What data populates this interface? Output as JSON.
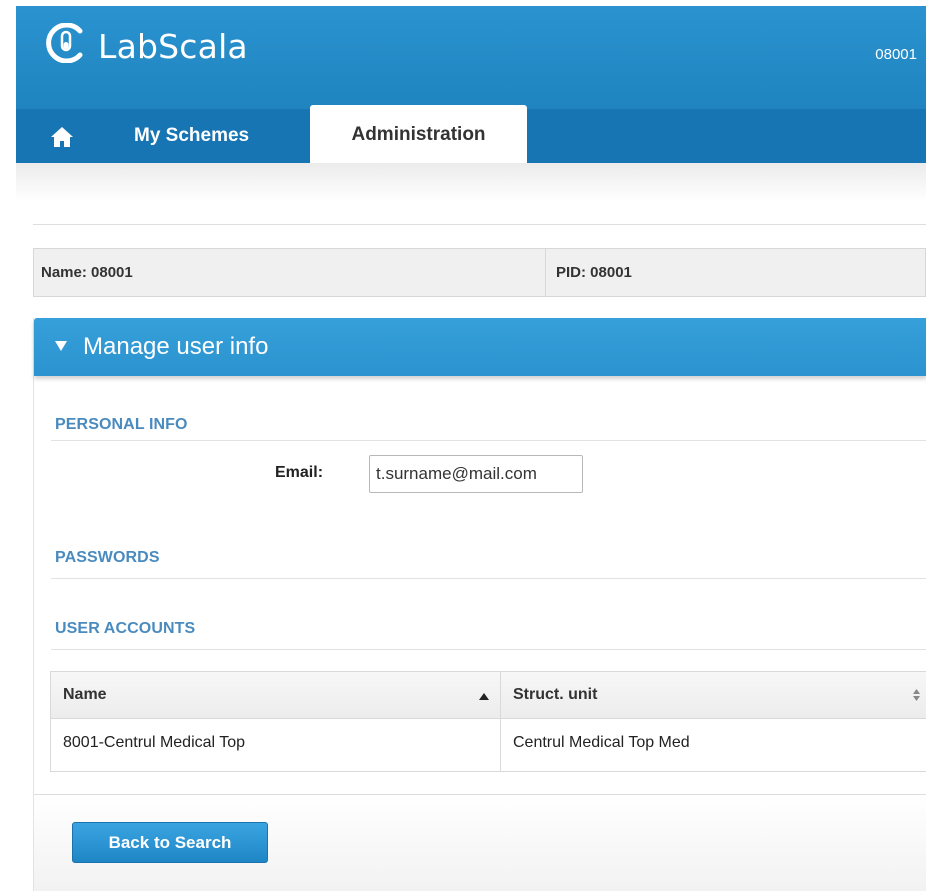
{
  "app": {
    "name": "LabScala",
    "user_id": "08001"
  },
  "nav": {
    "home_icon": "home-icon",
    "tabs": [
      {
        "label": "My Schemes",
        "active": false
      },
      {
        "label": "Administration",
        "active": true
      }
    ]
  },
  "info": {
    "name": "Name: 08001",
    "pid": "PID: 08001"
  },
  "panel": {
    "title": "Manage user info",
    "sections": {
      "personal": "PERSONAL INFO",
      "passwords": "PASSWORDS",
      "accounts": "USER ACCOUNTS"
    },
    "email": {
      "label": "Email:",
      "value": "t.surname@mail.com"
    },
    "table": {
      "columns": [
        "Name",
        "Struct. unit"
      ],
      "rows": [
        {
          "name": "8001-Centrul Medical Top",
          "unit": "Centrul Medical Top Med"
        }
      ]
    },
    "back_button": "Back to Search"
  },
  "colors": {
    "brand": "#1f84c0",
    "nav": "#1775b3",
    "panel_header": "#2b93cf",
    "section_title": "#4a8bbf"
  }
}
